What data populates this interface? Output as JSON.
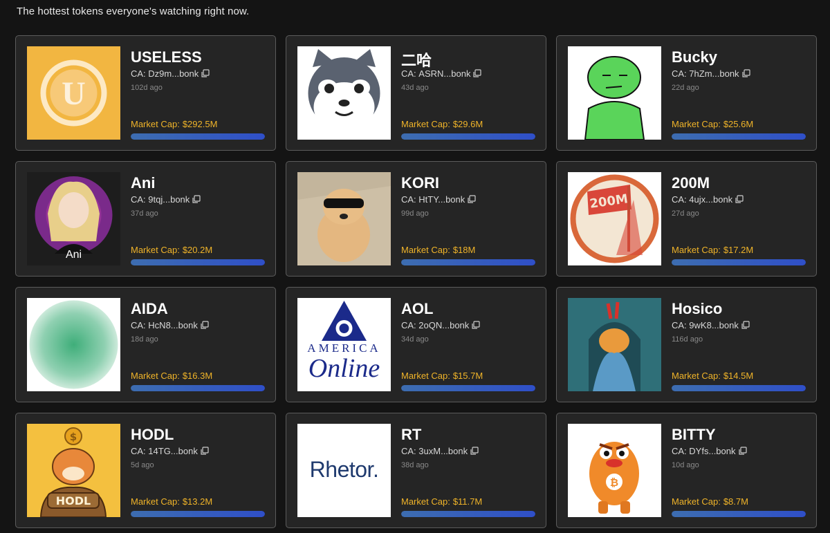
{
  "header": {
    "subtitle": "The hottest tokens everyone's watching right now."
  },
  "labels": {
    "ca_prefix": "CA:",
    "market_cap_prefix": "Market Cap:"
  },
  "tokens": [
    {
      "name": "USELESS",
      "ca": "Dz9m...bonk",
      "age": "102d ago",
      "market_cap": "$292.5M",
      "image": "useless-logo"
    },
    {
      "name": "二哈",
      "ca": "ASRN...bonk",
      "age": "43d ago",
      "market_cap": "$29.6M",
      "image": "husky-logo"
    },
    {
      "name": "Bucky",
      "ca": "7hZm...bonk",
      "age": "22d ago",
      "market_cap": "$25.6M",
      "image": "green-character-logo"
    },
    {
      "name": "Ani",
      "ca": "9tqj...bonk",
      "age": "37d ago",
      "market_cap": "$20.2M",
      "image": "anime-girl-logo",
      "image_caption": "Ani"
    },
    {
      "name": "KORI",
      "ca": "HtTY...bonk",
      "age": "99d ago",
      "market_cap": "$18M",
      "image": "dog-sunglasses-photo"
    },
    {
      "name": "200M",
      "ca": "4ujx...bonk",
      "age": "27d ago",
      "market_cap": "$17.2M",
      "image": "200m-flag-logo",
      "image_text": "200M"
    },
    {
      "name": "AIDA",
      "ca": "HcN8...bonk",
      "age": "18d ago",
      "market_cap": "$16.3M",
      "image": "green-gradient-circle"
    },
    {
      "name": "AOL",
      "ca": "2oQN...bonk",
      "age": "34d ago",
      "market_cap": "$15.7M",
      "image": "america-online-logo",
      "image_text_top": "AMERICA",
      "image_text_bottom": "Online"
    },
    {
      "name": "Hosico",
      "ca": "9wK8...bonk",
      "age": "116d ago",
      "market_cap": "$14.5M",
      "image": "cat-in-blanket-logo"
    },
    {
      "name": "HODL",
      "ca": "14TG...bonk",
      "age": "5d ago",
      "market_cap": "$13.2M",
      "image": "hodl-shiba-logo",
      "image_text": "HODL"
    },
    {
      "name": "RT",
      "ca": "3uxM...bonk",
      "age": "38d ago",
      "market_cap": "$11.7M",
      "image": "rhetor-logo",
      "image_text": "Rhetor."
    },
    {
      "name": "BITTY",
      "ca": "DYfs...bonk",
      "age": "10d ago",
      "market_cap": "$8.7M",
      "image": "orange-monster-logo"
    }
  ],
  "colors": {
    "background": "#141414",
    "card": "#252525",
    "card_border": "#5c5c5c",
    "market_cap": "#f0b429",
    "progress": "#2f4fc8"
  }
}
